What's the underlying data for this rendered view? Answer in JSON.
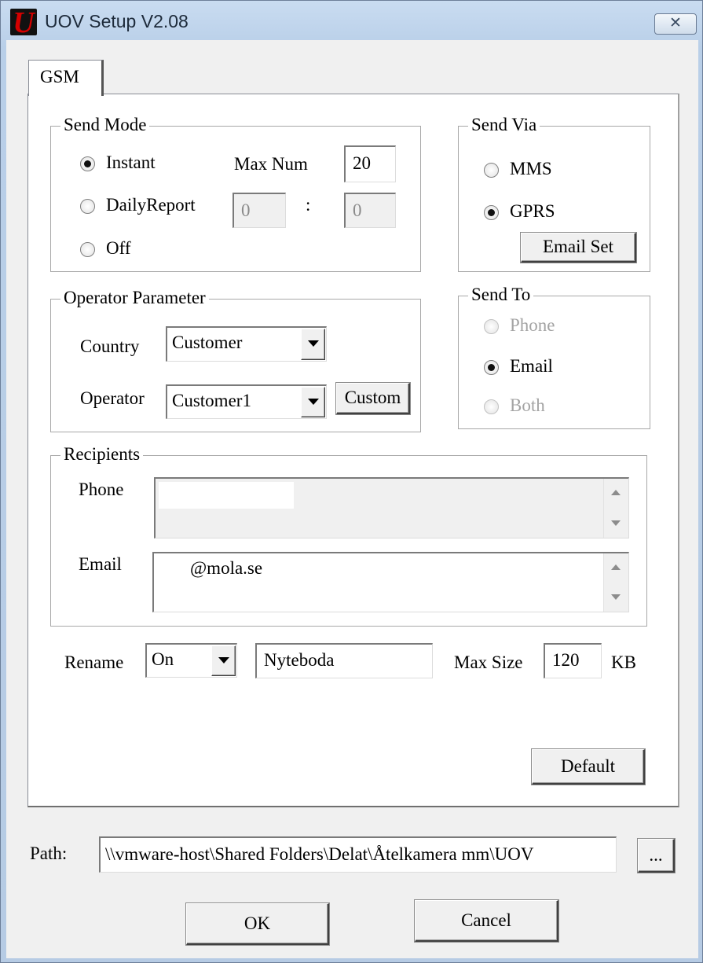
{
  "window": {
    "title": "UOV Setup V2.08",
    "logo_letter": "U",
    "close_glyph": "✕",
    "colors": {
      "logo_bg": "#111111",
      "logo_fg": "#d40000",
      "titlebar": "#c9dcf1"
    }
  },
  "tabs": [
    {
      "label": "GSM",
      "selected": true
    }
  ],
  "send_mode": {
    "title": "Send Mode",
    "options": [
      {
        "label": "Instant",
        "selected": true
      },
      {
        "label": "DailyReport",
        "selected": false
      },
      {
        "label": "Off",
        "selected": false
      }
    ],
    "max_num_label": "Max Num",
    "max_num_value": "20",
    "daily_hour": "0",
    "time_separator": ":",
    "daily_minute": "0"
  },
  "send_via": {
    "title": "Send Via",
    "options": [
      {
        "label": "MMS",
        "selected": false
      },
      {
        "label": "GPRS",
        "selected": true
      }
    ],
    "email_set_label": "Email Set"
  },
  "operator_parameter": {
    "title": "Operator Parameter",
    "country_label": "Country",
    "country_value": "Customer",
    "operator_label": "Operator",
    "operator_value": "Customer1",
    "custom_label": "Custom"
  },
  "send_to": {
    "title": "Send To",
    "options": [
      {
        "label": "Phone",
        "selected": false,
        "enabled": false
      },
      {
        "label": "Email",
        "selected": true,
        "enabled": true
      },
      {
        "label": "Both",
        "selected": false,
        "enabled": false
      }
    ]
  },
  "recipients": {
    "title": "Recipients",
    "phone_label": "Phone",
    "phone_value": "",
    "email_label": "Email",
    "email_value": "@mola.se"
  },
  "rename": {
    "label": "Rename",
    "mode_value": "On",
    "name_value": "Nyteboda",
    "max_size_label": "Max Size",
    "max_size_value": "120",
    "unit": "KB"
  },
  "default_label": "Default",
  "path": {
    "label": "Path:",
    "value": "\\\\vmware-host\\Shared Folders\\Delat\\Åtelkamera mm\\UOV",
    "browse_label": "..."
  },
  "ok_label": "OK",
  "cancel_label": "Cancel",
  "icons": [
    "app-logo-icon",
    "close-icon",
    "dropdown-arrow-icon",
    "scroll-up-icon",
    "scroll-down-icon"
  ]
}
